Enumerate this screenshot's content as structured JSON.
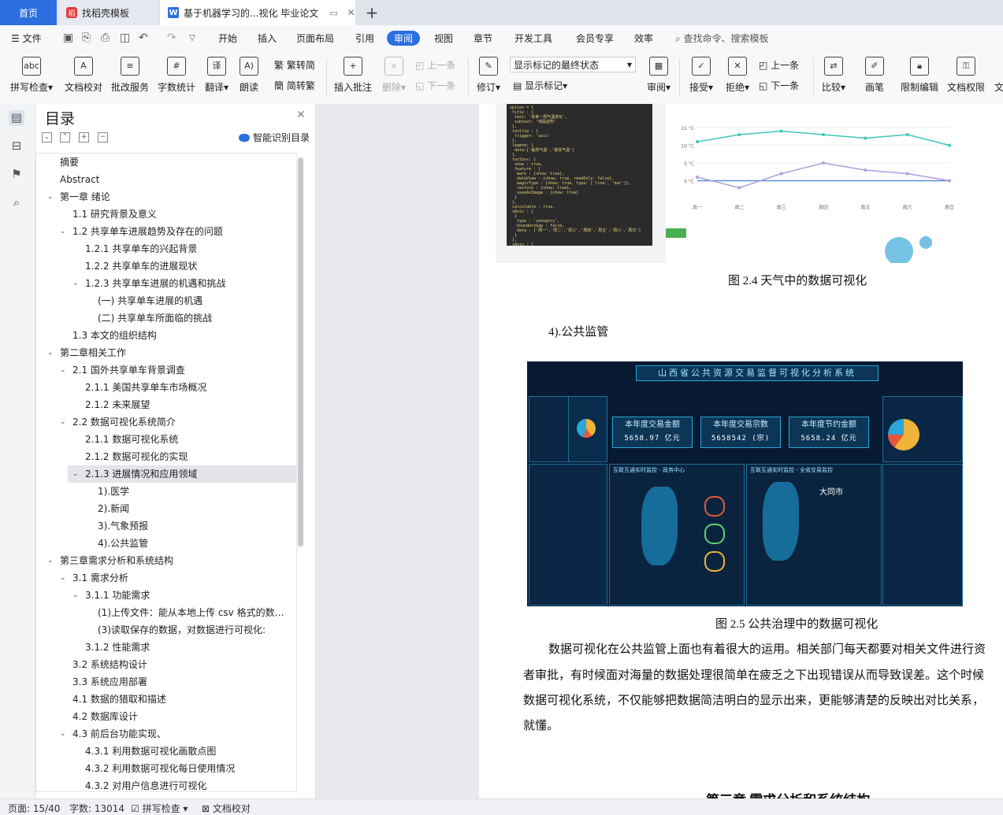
{
  "tabs": {
    "home": "首页",
    "templates": "找稻壳模板",
    "document": "基于机器学习的...视化 毕业论文"
  },
  "menu": {
    "file": "文件",
    "items": [
      "开始",
      "插入",
      "页面布局",
      "引用",
      "审阅",
      "视图",
      "章节",
      "开发工具",
      "会员专享",
      "效率"
    ],
    "active": "审阅",
    "search": "查找命令、搜索模板"
  },
  "ribbon": {
    "spellcheck": "拼写检查",
    "doc_proof": "文档校对",
    "batch_service": "批改服务",
    "word_count": "字数统计",
    "translate": "翻译",
    "read_aloud": "朗读",
    "to_traditional": "繁转简",
    "to_simplified": "简转繁",
    "insert_comment": "插入批注",
    "delete": "删除",
    "prev": "上一条",
    "next": "下一条",
    "revise": "修订",
    "markup_state": "显示标记的最终状态",
    "show_markup": "显示标记",
    "review": "审阅",
    "accept": "接受",
    "reject": "拒绝",
    "prev_change": "上一条",
    "next_change": "下一条",
    "compare": "比较",
    "pen": "画笔",
    "restrict_edit": "限制编辑",
    "doc_rights": "文档权限",
    "more": "文"
  },
  "toc": {
    "title": "目录",
    "smart": "智能识别目录",
    "items": [
      {
        "label": "摘要",
        "level": 0,
        "chev": ""
      },
      {
        "label": "Abstract",
        "level": 0,
        "chev": ""
      },
      {
        "label": "第一章  绪论",
        "level": 0,
        "chev": "v"
      },
      {
        "label": "1.1 研究背景及意义",
        "level": 1,
        "chev": ""
      },
      {
        "label": "1.2 共享单车进展趋势及存在的问题",
        "level": 1,
        "chev": "v"
      },
      {
        "label": "1.2.1 共享单车的兴起背景",
        "level": 2,
        "chev": ""
      },
      {
        "label": "1.2.2 共享单车的进展现状",
        "level": 2,
        "chev": ""
      },
      {
        "label": "1.2.3 共享单车进展的机遇和挑战",
        "level": 2,
        "chev": "v"
      },
      {
        "label": "(一)  共享单车进展的机遇",
        "level": 3,
        "chev": ""
      },
      {
        "label": "(二)  共享单车所面临的挑战",
        "level": 3,
        "chev": ""
      },
      {
        "label": "1.3  本文的组织结构",
        "level": 1,
        "chev": ""
      },
      {
        "label": "第二章相关工作",
        "level": 0,
        "chev": "v"
      },
      {
        "label": "2.1 国外共享单车背景调查",
        "level": 1,
        "chev": "v"
      },
      {
        "label": "2.1.1 美国共享单车市场概况",
        "level": 2,
        "chev": ""
      },
      {
        "label": "2.1.2  未来展望",
        "level": 2,
        "chev": ""
      },
      {
        "label": "2.2 数据可视化系统简介",
        "level": 1,
        "chev": "v"
      },
      {
        "label": "2.1.1 数据可视化系统",
        "level": 2,
        "chev": ""
      },
      {
        "label": "2.1.2  数据可视化的实现",
        "level": 2,
        "chev": ""
      },
      {
        "label": "2.1.3 进展情况和应用领域",
        "level": 2,
        "chev": "v",
        "selected": true
      },
      {
        "label": "1).医学",
        "level": 3,
        "chev": ""
      },
      {
        "label": "2).新闻",
        "level": 3,
        "chev": ""
      },
      {
        "label": "3).气象预报",
        "level": 3,
        "chev": ""
      },
      {
        "label": "4).公共监管",
        "level": 3,
        "chev": ""
      },
      {
        "label": "第三章需求分析和系统结构",
        "level": 0,
        "chev": "v"
      },
      {
        "label": "3.1 需求分析",
        "level": 1,
        "chev": "v"
      },
      {
        "label": "3.1.1 功能需求",
        "level": 2,
        "chev": "v"
      },
      {
        "label": "(1)上传文件：能从本地上传 csv 格式的数据 ...",
        "level": 3,
        "chev": ""
      },
      {
        "label": "(3)读取保存的数据，对数据进行可视化:",
        "level": 3,
        "chev": ""
      },
      {
        "label": "3.1.2 性能需求",
        "level": 2,
        "chev": ""
      },
      {
        "label": "3.2 系统结构设计",
        "level": 1,
        "chev": ""
      },
      {
        "label": "3.3 系统应用部署",
        "level": 1,
        "chev": ""
      },
      {
        "label": "4.1 数据的猎取和描述",
        "level": 1,
        "chev": ""
      },
      {
        "label": "4.2 数据库设计",
        "level": 1,
        "chev": ""
      },
      {
        "label": "4.3 前后台功能实现、",
        "level": 1,
        "chev": "v"
      },
      {
        "label": "4.3.1 利用数据可视化画散点图",
        "level": 2,
        "chev": ""
      },
      {
        "label": "4.3.2 利用数据可视化每日使用情况",
        "level": 2,
        "chev": ""
      },
      {
        "label": "4.3.2  对用户信息进行可视化",
        "level": 2,
        "chev": ""
      }
    ]
  },
  "doc": {
    "fig24_caption": "图 2.4  天气中的数据可视化",
    "section_heading": "4).公共监管",
    "fig25_caption": "图 2.5  公共治理中的数据可视化",
    "para_lines": [
      "数据可视化在公共监管上面也有着很大的运用。相关部门每天都要对相关文件进行资",
      "者审批，有时候面对海量的数据处理很简单在疲乏之下出现错误从而导致误差。这个时候",
      "数据可视化系统，不仅能够把数据简洁明白的显示出来，更能够清楚的反映出对比关系，",
      "就懂。"
    ],
    "next_chapter": "第三章  需求分析和系统结构",
    "dashboard_title": "山西省公共资源交易监督可视化分析系统",
    "kpis": [
      {
        "label": "本年度交易金额",
        "value": "5658.97 亿元"
      },
      {
        "label": "本年度交易宗数",
        "value": "5658542 (宗)"
      },
      {
        "label": "本年度节约金额",
        "value": "5658.24 亿元"
      }
    ],
    "panel_a": "互联互通实时监控 - 政务中心",
    "panel_b": "互联互通实时监控 - 全省交易监控",
    "city": "大同市",
    "chart_weather": {
      "temps_high": [
        11,
        13,
        14,
        13,
        12,
        13,
        10
      ],
      "temps_low": [
        1,
        -2,
        2,
        5,
        3,
        2,
        0
      ],
      "days": [
        "周一",
        "周二",
        "周三",
        "周四",
        "周五",
        "周六",
        "周日"
      ]
    }
  },
  "status": {
    "page": "页面: 15/40",
    "words": "字数: 13014",
    "spellcheck": "拼写检查",
    "proofread": "文档校对"
  },
  "colors": {
    "accent": "#2b6fe0",
    "dashboard_bg": "#071a32"
  }
}
